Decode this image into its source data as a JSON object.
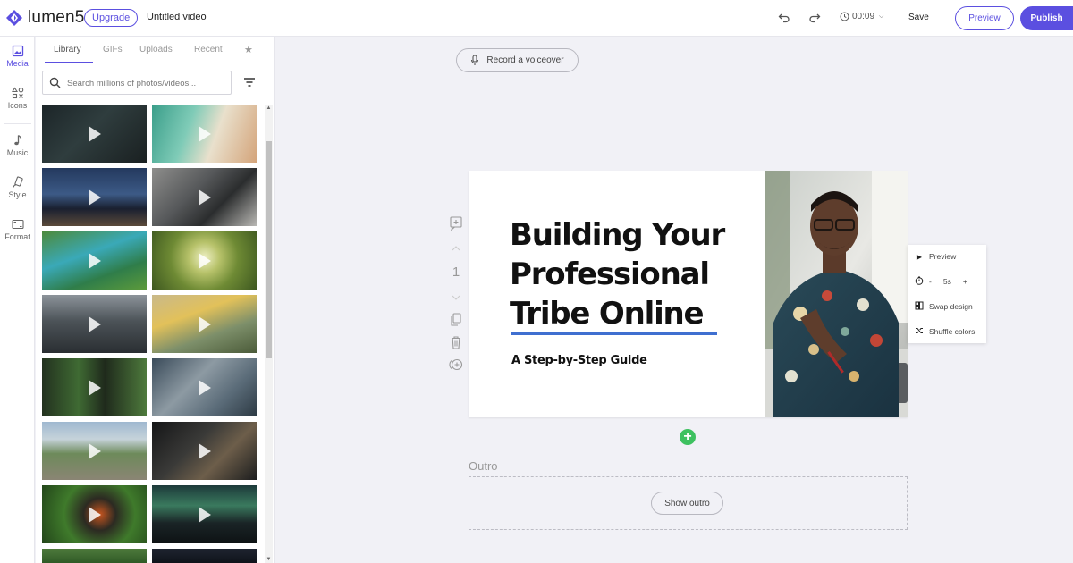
{
  "header": {
    "logo_text": "lumen5",
    "upgrade_label": "Upgrade",
    "video_title": "Untitled video",
    "timer": "00:09",
    "save_label": "Save",
    "preview_label": "Preview",
    "publish_label": "Publish",
    "accent_color": "#5b4fe0"
  },
  "rail": {
    "items": [
      {
        "label": "Media",
        "icon": "image-icon",
        "active": true
      },
      {
        "label": "Icons",
        "icon": "shapes-icon"
      },
      {
        "label": "Music",
        "icon": "music-note-icon"
      },
      {
        "label": "Style",
        "icon": "brush-icon"
      },
      {
        "label": "Format",
        "icon": "aspect-ratio-icon"
      }
    ]
  },
  "media_panel": {
    "tabs": [
      {
        "label": "Library",
        "active": true
      },
      {
        "label": "GIFs"
      },
      {
        "label": "Uploads"
      },
      {
        "label": "Recent"
      },
      {
        "label": "★",
        "icon": "star-icon"
      }
    ],
    "search_placeholder": "Search millions of photos/videos...",
    "thumbnails": [
      {
        "subject": "dark rainy glass",
        "kind": "video"
      },
      {
        "subject": "beach waves aerial",
        "kind": "video"
      },
      {
        "subject": "city skyline at night",
        "kind": "video"
      },
      {
        "subject": "man working at desk",
        "kind": "video"
      },
      {
        "subject": "aerial river valley",
        "kind": "video"
      },
      {
        "subject": "dandelion flowers",
        "kind": "video"
      },
      {
        "subject": "crowded city street",
        "kind": "video"
      },
      {
        "subject": "construction workers",
        "kind": "video"
      },
      {
        "subject": "green building facade",
        "kind": "video"
      },
      {
        "subject": "aerial city streets",
        "kind": "video"
      },
      {
        "subject": "coastal town aerial",
        "kind": "video"
      },
      {
        "subject": "man at laptop in dark office",
        "kind": "video"
      },
      {
        "subject": "butterfly on leaf",
        "kind": "video"
      },
      {
        "subject": "aurora over mountains",
        "kind": "video"
      },
      {
        "subject": "forest",
        "kind": "video"
      },
      {
        "subject": "night scene",
        "kind": "video"
      }
    ]
  },
  "editor": {
    "voiceover_label": "Record a voiceover",
    "scene_number": "1",
    "slide": {
      "title": "Building Your Professional Tribe Online",
      "subtitle": "A Step-by-Step Guide",
      "underline_color": "#3f6fd0"
    },
    "context_menu": {
      "preview": "Preview",
      "duration": "5s",
      "minus": "-",
      "plus": "+",
      "swap_design": "Swap design",
      "shuffle_colors": "Shuffle colors"
    },
    "outro_label": "Outro",
    "show_outro_label": "Show outro",
    "add_scene_color": "#3ec160"
  }
}
